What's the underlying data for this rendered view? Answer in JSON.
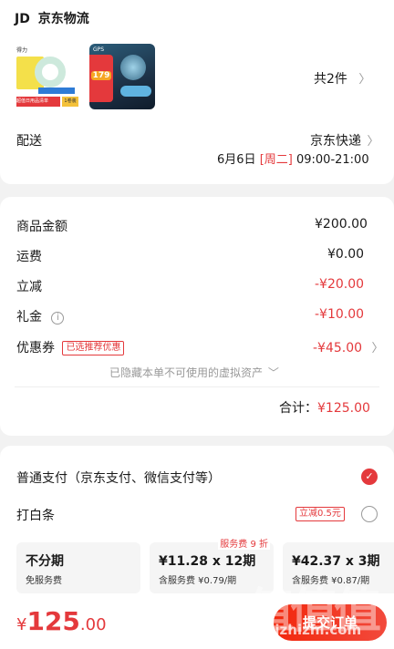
{
  "shop": {
    "logo": "JD",
    "name": "京东物流"
  },
  "products": {
    "count_label": "共2件"
  },
  "delivery": {
    "label": "配送",
    "method": "京东快递",
    "date": "6月6日",
    "weekday": "[周二]",
    "time": "09:00-21:00"
  },
  "thumb1": {
    "brand": "得力",
    "tag_red": "超值日用品清单",
    "tag_yellow": "1卷装"
  },
  "thumb2": {
    "price": "179",
    "top_text": "GPS"
  },
  "price_rows": [
    {
      "label": "商品金额",
      "value": "¥200.00"
    },
    {
      "label": "运费",
      "value": "¥0.00"
    },
    {
      "label": "立减",
      "value": "-¥20.00"
    },
    {
      "label": "礼金",
      "value": "-¥10.00"
    },
    {
      "label": "优惠券",
      "value": "-¥45.00",
      "tag": "已选推荐优惠"
    }
  ],
  "hidden_note": "已隐藏本单不可使用的虚拟资产",
  "total": {
    "label": "合计：",
    "value": "¥125.00"
  },
  "payment": {
    "normal": "普通支付（京东支付、微信支付等）",
    "baitiao": "打白条",
    "baitiao_tag": "立减0.5元",
    "plans": [
      {
        "title": "不分期",
        "sub": "免服务费",
        "badge": ""
      },
      {
        "title": "¥11.28 x 12期",
        "sub": "含服务费 ¥0.79/期",
        "badge": "服务费 9 折"
      },
      {
        "title": "¥42.37 x 3期",
        "sub": "含服务费 ¥0.87/期",
        "badge": ""
      }
    ]
  },
  "bottom": {
    "currency": "¥",
    "integer": "125",
    "decimal": ".00",
    "submit": "提交订单"
  },
  "watermark": {
    "text": "值值值",
    "sub": "zhizhizhi.com"
  },
  "colors": {
    "accent": "#e4393c",
    "background": "#f2f2f2"
  }
}
